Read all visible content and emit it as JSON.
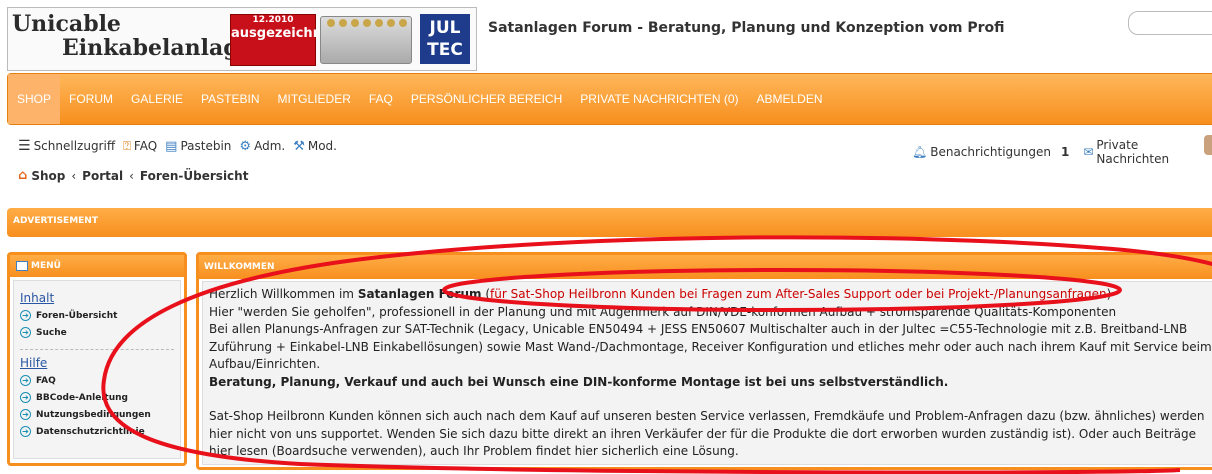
{
  "header": {
    "logo": {
      "line1": "Unicable",
      "line2": "Einkabelanlagen",
      "badge_top": "12.2010",
      "badge_award": "ausgezeichnet",
      "brand": "JUL TEC"
    },
    "site_title": "Satanlagen Forum - Beratung, Planung und Konzeption vom Profi"
  },
  "nav": {
    "items": [
      {
        "label": "SHOP",
        "active": true
      },
      {
        "label": "FORUM"
      },
      {
        "label": "GALERIE"
      },
      {
        "label": "PASTEBIN"
      },
      {
        "label": "MITGLIEDER"
      },
      {
        "label": "FAQ"
      },
      {
        "label": "PERSÖNLICHER BEREICH"
      },
      {
        "label": "PRIVATE NACHRICHTEN (0)"
      },
      {
        "label": "ABMELDEN"
      }
    ]
  },
  "quicklinks": {
    "schnellzugriff": "Schnellzugriff",
    "faq": "FAQ",
    "pastebin": "Pastebin",
    "adm": "Adm.",
    "mod": "Mod.",
    "notifications": "Benachrichtigungen",
    "notifications_count": "1",
    "private_messages": "Private Nachrichten"
  },
  "breadcrumb": {
    "items": [
      "Shop",
      "Portal",
      "Foren-Übersicht"
    ]
  },
  "ad_bar": {
    "label": "ADVERTISEMENT"
  },
  "menu": {
    "title": "MENÜ",
    "groups": [
      {
        "title": "Inhalt",
        "items": [
          "Foren-Übersicht",
          "Suche"
        ]
      },
      {
        "title": "Hilfe",
        "items": [
          "FAQ",
          "BBCode-Anleitung",
          "Nutzungsbedingungen",
          "Datenschutzrichtlinie"
        ]
      }
    ]
  },
  "welcome": {
    "title": "WILLKOMMEN",
    "p1_a": "Herzlich Willkommen im ",
    "p1_b": "Satanlagen Forum",
    "p1_c": " (",
    "p1_red": "für Sat-Shop Heilbronn Kunden bei Fragen zum After-Sales Support oder bei Projekt-/Planungsanfragen",
    "p1_d": ")",
    "p2": "Hier \"werden Sie geholfen\", professionell in der Planung und mit Augenmerk auf DIN/VDE-konformen Aufbau + stromsparende Qualitäts-Komponenten",
    "p3": "Bei allen Planungs-Anfragen zur SAT-Technik (Legacy, Unicable EN50494 + JESS EN50607 Multischalter auch in der Jultec =C55-Technologie mit z.B. Breitband-LNB Zuführung + Einkabel-LNB Einkabellösungen) sowie Mast Wand-/Dachmontage, Receiver Konfiguration und etliches mehr oder auch nach ihrem Kauf mit Service beim Aufbau/Einrichten.",
    "p4": "Beratung, Planung, Verkauf und auch bei Wunsch eine DIN-konforme Montage ist bei uns selbstverständlich.",
    "p5": "Sat-Shop Heilbronn Kunden können sich auch nach dem Kauf auf unseren besten Service verlassen, Fremdkäufe und Problem-Anfragen dazu (bzw. ähnliches) werden hier nicht von uns supportet. Wenden Sie sich dazu bitte direkt an ihren Verkäufer der für die Produkte die dort erworben wurden zuständig ist). Oder auch Beiträge hier lesen (Boardsuche verwenden), auch Ihr Problem findet hier sicherlich eine Lösung."
  },
  "colors": {
    "accent": "#f78f1e",
    "annotation": "#e8101a",
    "link": "#2956a4"
  }
}
